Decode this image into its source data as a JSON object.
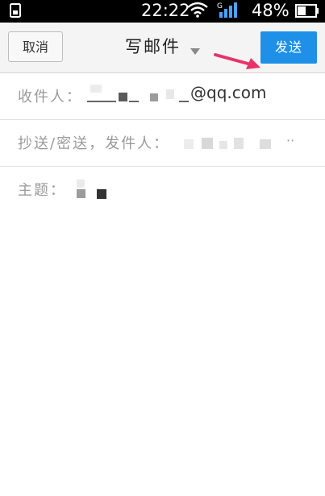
{
  "status_bar": {
    "time": "22:22",
    "battery_percent": "48%",
    "network_type": "G",
    "icons": [
      "sim-icon",
      "wifi-icon",
      "signal-icon",
      "battery-icon"
    ]
  },
  "header": {
    "cancel_label": "取消",
    "title": "写邮件",
    "send_label": "发送"
  },
  "compose": {
    "to_label": "收件人：",
    "to_value_suffix": "@qq.com",
    "cc_label": "抄送/密送，发件人：",
    "cc_overflow": "··",
    "subject_label": "主题："
  },
  "colors": {
    "send_button": "#1e90e8",
    "annotation_arrow": "#e8336a"
  }
}
